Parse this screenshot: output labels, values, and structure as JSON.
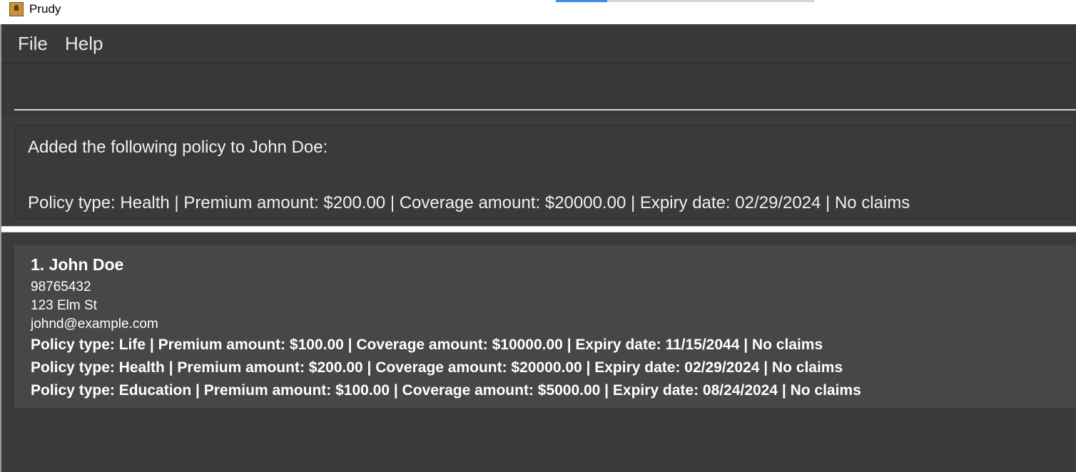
{
  "window": {
    "title": "Prudy"
  },
  "menu": {
    "file_label": "File",
    "help_label": "Help"
  },
  "command": {
    "value": "",
    "placeholder": ""
  },
  "result": {
    "line1": "Added the following policy to John Doe:",
    "line2": "Policy type: Health | Premium amount: $200.00 | Coverage amount: $20000.00 | Expiry date: 02/29/2024 | No claims"
  },
  "persons": [
    {
      "name": "1. John Doe",
      "phone": "98765432",
      "address": "123 Elm St",
      "email": "johnd@example.com",
      "policies": [
        "Policy type: Life | Premium amount: $100.00 | Coverage amount: $10000.00 | Expiry date: 11/15/2044 | No claims",
        "Policy type: Health | Premium amount: $200.00 | Coverage amount: $20000.00 | Expiry date: 02/29/2024 | No claims",
        "Policy type: Education | Premium amount: $100.00 | Coverage amount: $5000.00 | Expiry date: 08/24/2024 | No claims"
      ]
    }
  ],
  "colors": {
    "background": "#3b3b3b",
    "card": "#474749",
    "taskbar_accent": "#3a8ee6"
  },
  "icons": {
    "app": "address-book-icon"
  }
}
